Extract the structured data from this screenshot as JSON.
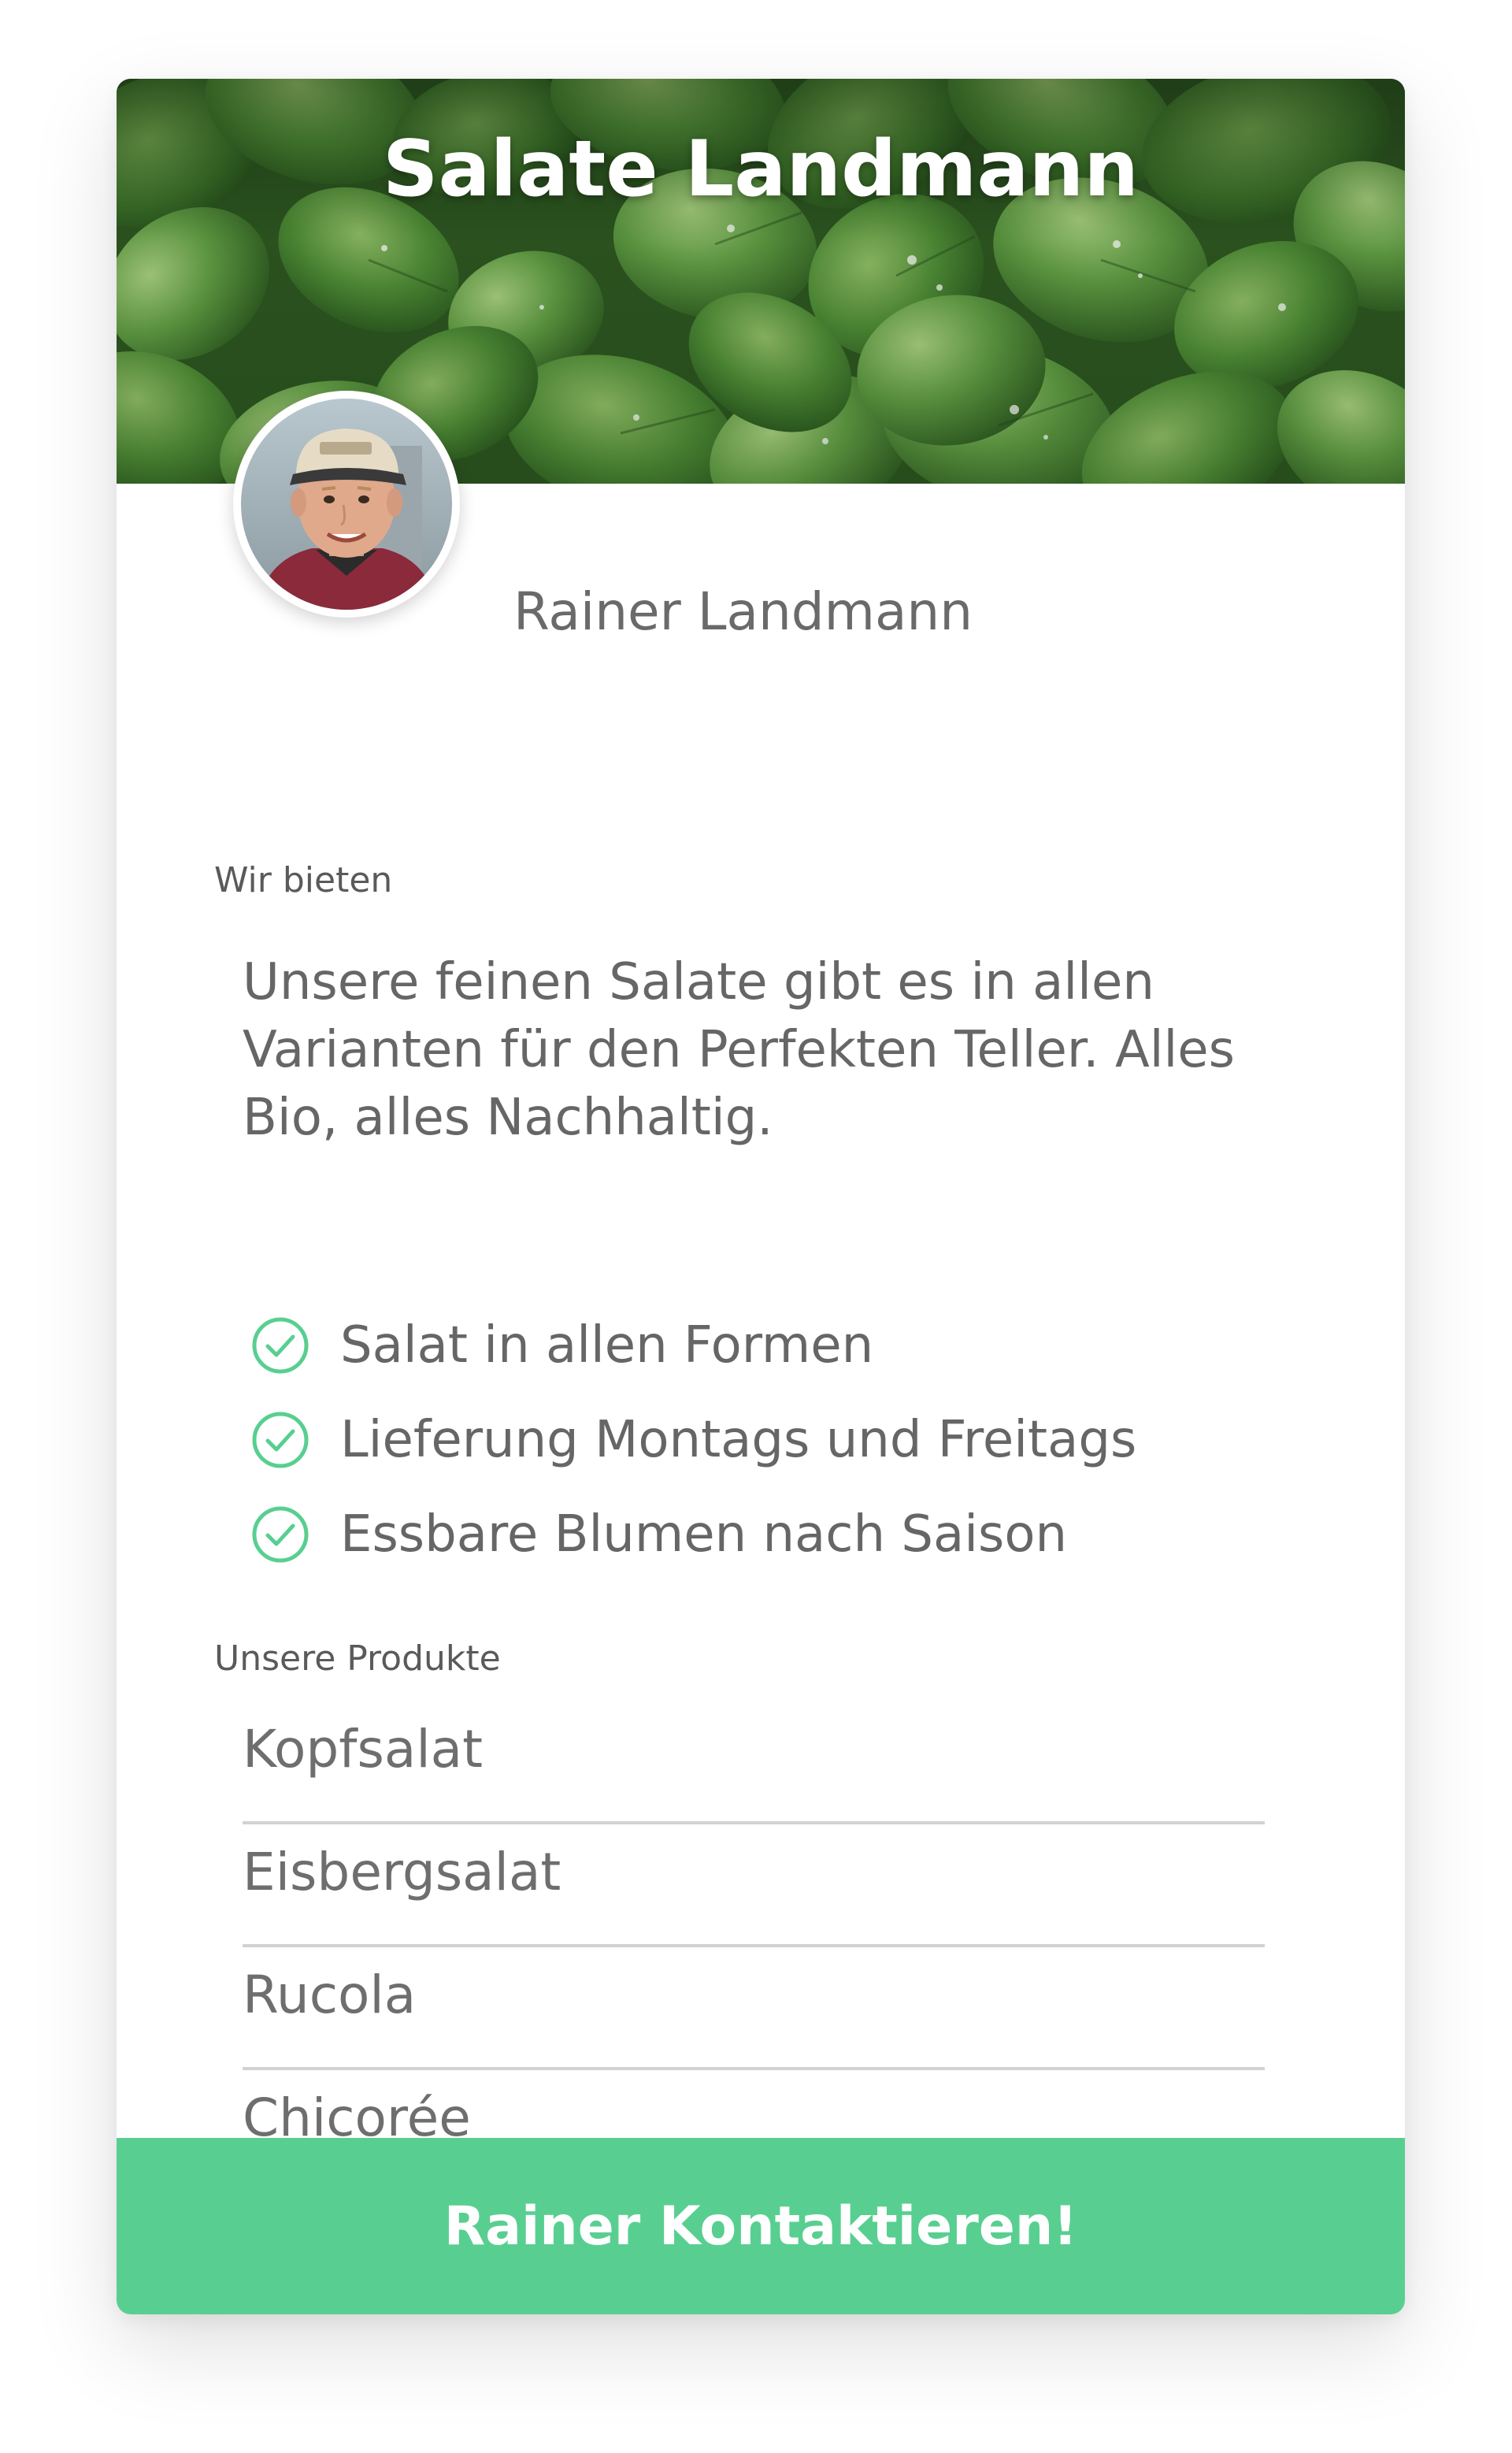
{
  "hero": {
    "title": "Salate Landmann",
    "image": "lamb-lettuce-leaves-photo"
  },
  "farmer": {
    "name": "Rainer Landmann",
    "avatar": "farmer-portrait-photo"
  },
  "offer": {
    "label": "Wir bieten",
    "description": "Unsere feinen Salate gibt es in allen Varianten für den Perfekten Teller. Alles Bio, alles Nachhaltig.",
    "features": [
      {
        "text": "Salat in allen Formen",
        "icon": "check-circle-icon"
      },
      {
        "text": "Lieferung Montags und Freitags",
        "icon": "check-circle-icon"
      },
      {
        "text": "Essbare Blumen nach Saison",
        "icon": "check-circle-icon"
      }
    ]
  },
  "products": {
    "label": "Unsere Produkte",
    "items": [
      "Kopfsalat",
      "Eisbergsalat",
      "Rucola",
      "Chicorée"
    ]
  },
  "contact": {
    "button_label": "Rainer Kontaktieren!"
  },
  "colors": {
    "accent": "#58cf90",
    "check": "#58cf90",
    "text": "#666666",
    "divider": "#d2d2d2"
  }
}
